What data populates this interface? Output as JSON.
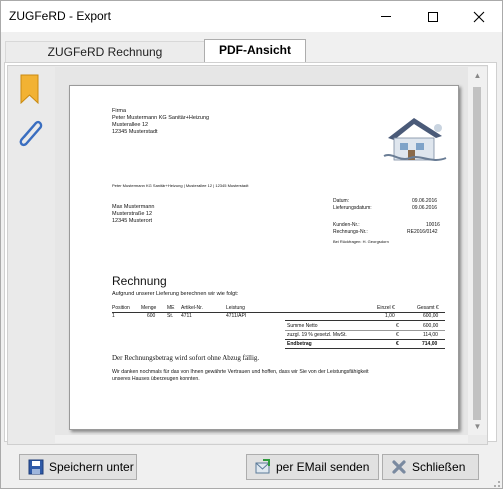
{
  "window": {
    "title": "ZUGFeRD - Export"
  },
  "tabs": [
    {
      "label": "ZUGFeRD Rechnung"
    },
    {
      "label": "PDF-Ansicht"
    }
  ],
  "invoice": {
    "sender": [
      "Firma",
      "Peter Mustermann KG Sanitär+Heizung",
      "Musterallee 12",
      "12345 Musterstadt"
    ],
    "sender_line": "Peter Mustermann KG Sanitär+Heizung  |  Musterallee 12  |  12345 Musterstadt",
    "recipient": [
      "Max Mustermann",
      "Musterstraße 12",
      "12345 Musterort"
    ],
    "meta": [
      {
        "label": "Datum:",
        "value": "09.06.2016"
      },
      {
        "label": "Lieferungsdatum:",
        "value": "09.06.2016"
      },
      {
        "label": "Kunden-Nr.:",
        "value": "10016"
      },
      {
        "label": "Rechnungs-Nr.:",
        "value": "RE2016/0142"
      }
    ],
    "contact_note": "Bei Rückfragen: H. Georgsdorn",
    "heading": "Rechnung",
    "intro": "Aufgrund unserer Lieferung berechnen wir wie folgt:",
    "columns": [
      "Position",
      "Menge",
      "ME",
      "Artikel-Nr.",
      "Leistung",
      "Einzel €",
      "Gesamt €"
    ],
    "items": [
      {
        "pos": "1",
        "qty": "600",
        "unit": "St.",
        "article": "4711",
        "desc": "4711/API",
        "unit_price": "1,00",
        "total": "600,00"
      }
    ],
    "totals": [
      {
        "label": "Summe Netto",
        "cur": "€",
        "value": "600,00"
      },
      {
        "label": "zuzgl. 19 % gesetzl. MwSt.",
        "cur": "€",
        "value": "114,00"
      },
      {
        "label": "Endbetrag",
        "cur": "€",
        "value": "714,00"
      }
    ],
    "note_serif": "Der Rechnungsbetrag wird sofort ohne Abzug fällig.",
    "thanks_1": "Wir danken nochmals für das von Ihnen gewährte Vertrauen und hoffen, dass wir Sie von der Leistungsfähigkeit",
    "thanks_2": "unseres Hauses überzeugen konnten."
  },
  "buttons": {
    "save": "Speichern unter",
    "mail": "per EMail senden",
    "close": "Schließen"
  },
  "colors": {
    "bookmark": "#f0b030",
    "paperclip": "#3a6ec0",
    "viewer_bg": "#eaeaea"
  }
}
